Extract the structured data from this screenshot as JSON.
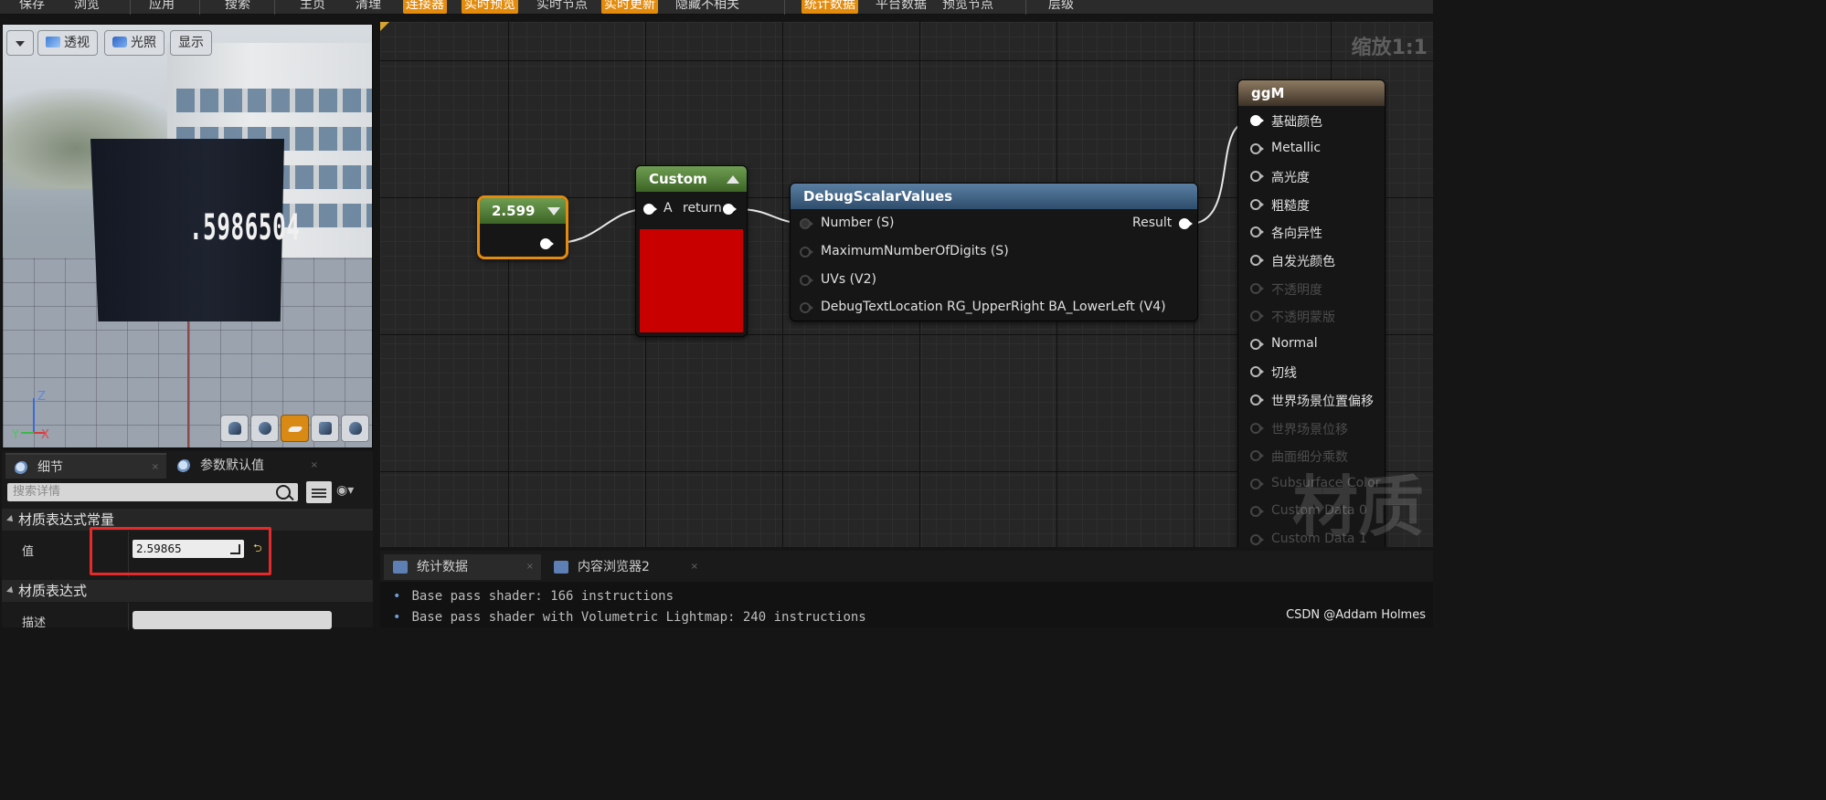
{
  "toolbar": {
    "items": [
      "保存",
      "浏览",
      "应用",
      "搜索",
      "主页",
      "清理",
      "连接器",
      "实时预览",
      "实时节点",
      "实时更新",
      "隐藏不相关",
      "统计数据",
      "平台数据",
      "预览节点",
      "层级"
    ],
    "active_color": "#e38b0c"
  },
  "viewport": {
    "buttons": {
      "perspective": "透视",
      "lit": "光照",
      "show": "显示"
    },
    "debug_number": ".5986504",
    "axis": {
      "z": "Z",
      "x": "X",
      "y": "Y"
    },
    "preview_icons": [
      "cylinder-icon",
      "sphere-icon",
      "plane-icon",
      "cube-icon",
      "teapot-icon"
    ]
  },
  "details": {
    "tabs": [
      {
        "label": "细节"
      },
      {
        "label": "参数默认值"
      }
    ],
    "search_placeholder": "搜索详情",
    "categories": {
      "constant": "材质表达式常量",
      "expression": "材质表达式"
    },
    "props": {
      "value_label": "值",
      "value": "2.59865",
      "description_label": "描述"
    },
    "highlight_color": "#e42a2a"
  },
  "graph": {
    "zoom": "缩放1:1",
    "watermark": "材质",
    "constant_node": {
      "title": "2.599",
      "color": "#e38b0c"
    },
    "custom_node": {
      "title": "Custom",
      "input": "A",
      "output": "return",
      "preview_color": "#c80000"
    },
    "debug_node": {
      "title": "DebugScalarValues",
      "inputs": [
        "Number (S)",
        "MaximumNumberOfDigits (S)",
        "UVs (V2)",
        "DebugTextLocation RG_UpperRight BA_LowerLeft (V4)"
      ],
      "output": "Result"
    },
    "material_node": {
      "title": "ggM",
      "pins": [
        {
          "label": "基础颜色",
          "state": "connected"
        },
        {
          "label": "Metallic",
          "state": "enabled"
        },
        {
          "label": "高光度",
          "state": "enabled"
        },
        {
          "label": "粗糙度",
          "state": "enabled"
        },
        {
          "label": "各向异性",
          "state": "enabled"
        },
        {
          "label": "自发光颜色",
          "state": "enabled"
        },
        {
          "label": "不透明度",
          "state": "disabled"
        },
        {
          "label": "不透明蒙版",
          "state": "disabled"
        },
        {
          "label": "Normal",
          "state": "enabled"
        },
        {
          "label": "切线",
          "state": "enabled"
        },
        {
          "label": "世界场景位置偏移",
          "state": "enabled"
        },
        {
          "label": "世界场景位移",
          "state": "disabled"
        },
        {
          "label": "曲面细分乘数",
          "state": "disabled"
        },
        {
          "label": "Subsurface Color",
          "state": "disabled"
        },
        {
          "label": "Custom Data 0",
          "state": "disabled"
        },
        {
          "label": "Custom Data 1",
          "state": "disabled"
        }
      ]
    }
  },
  "stats": {
    "tabs": [
      {
        "label": "统计数据"
      },
      {
        "label": "内容浏览器2"
      }
    ],
    "lines": [
      "Base pass shader: 166 instructions",
      "Base pass shader with Volumetric Lightmap: 240 instructions"
    ],
    "credit": "CSDN @Addam Holmes"
  }
}
